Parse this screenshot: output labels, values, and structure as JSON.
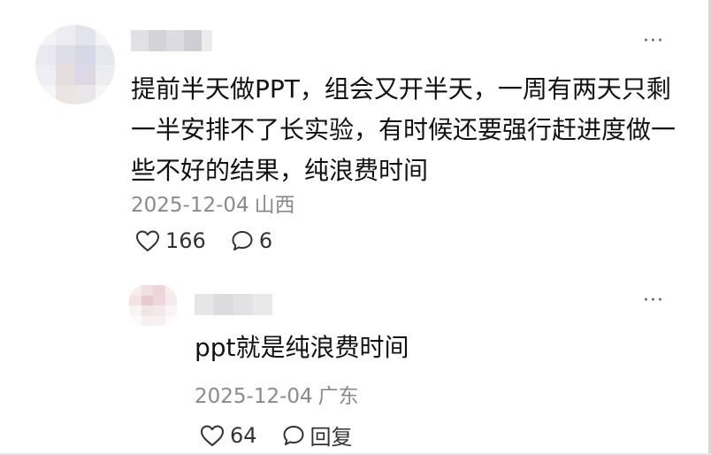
{
  "comment": {
    "text": "提前半天做PPT，组会又开半天，一周有两天只剩一半安排不了长实验，有时候还要强行赶进度做一些不好的结果，纯浪费时间",
    "date": "2025-12-04",
    "location": "山西",
    "likes": "166",
    "replies": "6",
    "more_label": "···"
  },
  "reply": {
    "text": "ppt就是纯浪费时间",
    "date": "2025-12-04",
    "location": "广东",
    "likes": "64",
    "reply_label": "回复",
    "more_label": "···"
  },
  "icons": {
    "like": "heart-outline-icon",
    "comment": "speech-bubble-icon",
    "more": "ellipsis-icon"
  },
  "colors": {
    "text": "#111111",
    "meta": "#8a8a8a",
    "icon": "#333333"
  }
}
